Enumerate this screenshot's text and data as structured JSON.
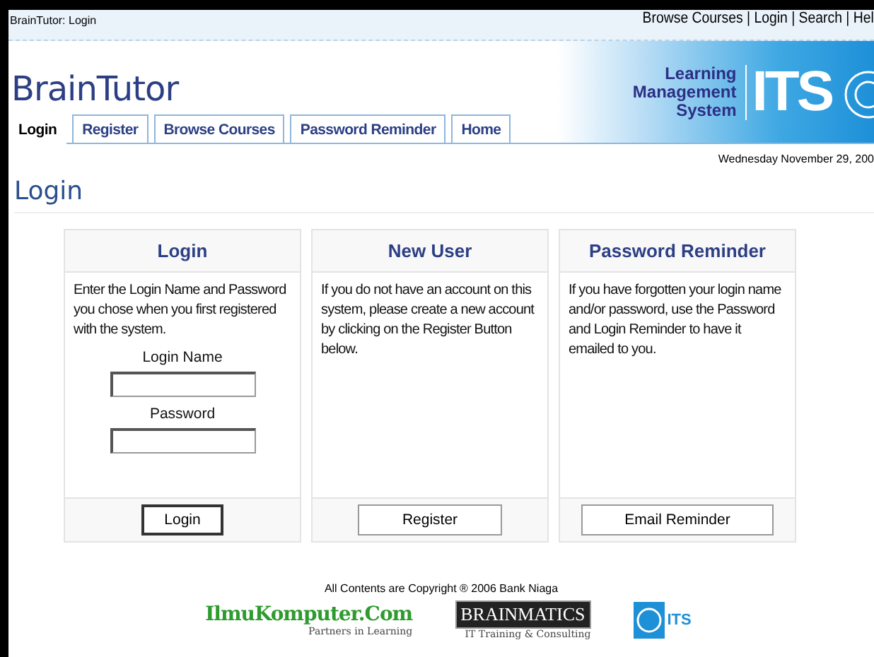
{
  "window": {
    "title": "BrainTutor: Login"
  },
  "top_links": "Browse Courses | Login | Search | Hel",
  "site_title": "BrainTutor",
  "banner": {
    "lines": [
      "Learning",
      "Management",
      "System"
    ],
    "logo": "ITS"
  },
  "tabs": [
    {
      "label": "Login",
      "selected": true
    },
    {
      "label": "Register",
      "selected": false
    },
    {
      "label": "Browse Courses",
      "selected": false
    },
    {
      "label": "Password Reminder",
      "selected": false
    },
    {
      "label": "Home",
      "selected": false
    }
  ],
  "date": "Wednesday November 29, 200",
  "page_heading": "Login",
  "panels": [
    {
      "kind": "login",
      "title": "Login",
      "text": "Enter the Login Name and Password you chose when you first registered with the system.",
      "fields": [
        "Login Name",
        "Password"
      ],
      "button": "Login",
      "default": true
    },
    {
      "kind": "info",
      "title": "New User",
      "text": "If you do not have an account on this system, please create a new account by clicking on the Register Button below.",
      "button": "Register",
      "default": false
    },
    {
      "kind": "info",
      "title": "Password Reminder",
      "text": "If you have forgotten your login name and/or password, use the Password and Login Reminder to have it emailed to you.",
      "button": "Email Reminder",
      "default": false
    }
  ],
  "footer": {
    "copyright": "All Contents are Copyright ® 2006 Bank Niaga",
    "partners": [
      {
        "kind": "ilmu",
        "name": "IlmuKomputer.Com",
        "tagline": "Partners in Learning"
      },
      {
        "kind": "brainmatics",
        "name": "BRAINMATICS",
        "tagline": "IT Training & Consulting"
      },
      {
        "kind": "its",
        "name": "ITS"
      }
    ]
  }
}
